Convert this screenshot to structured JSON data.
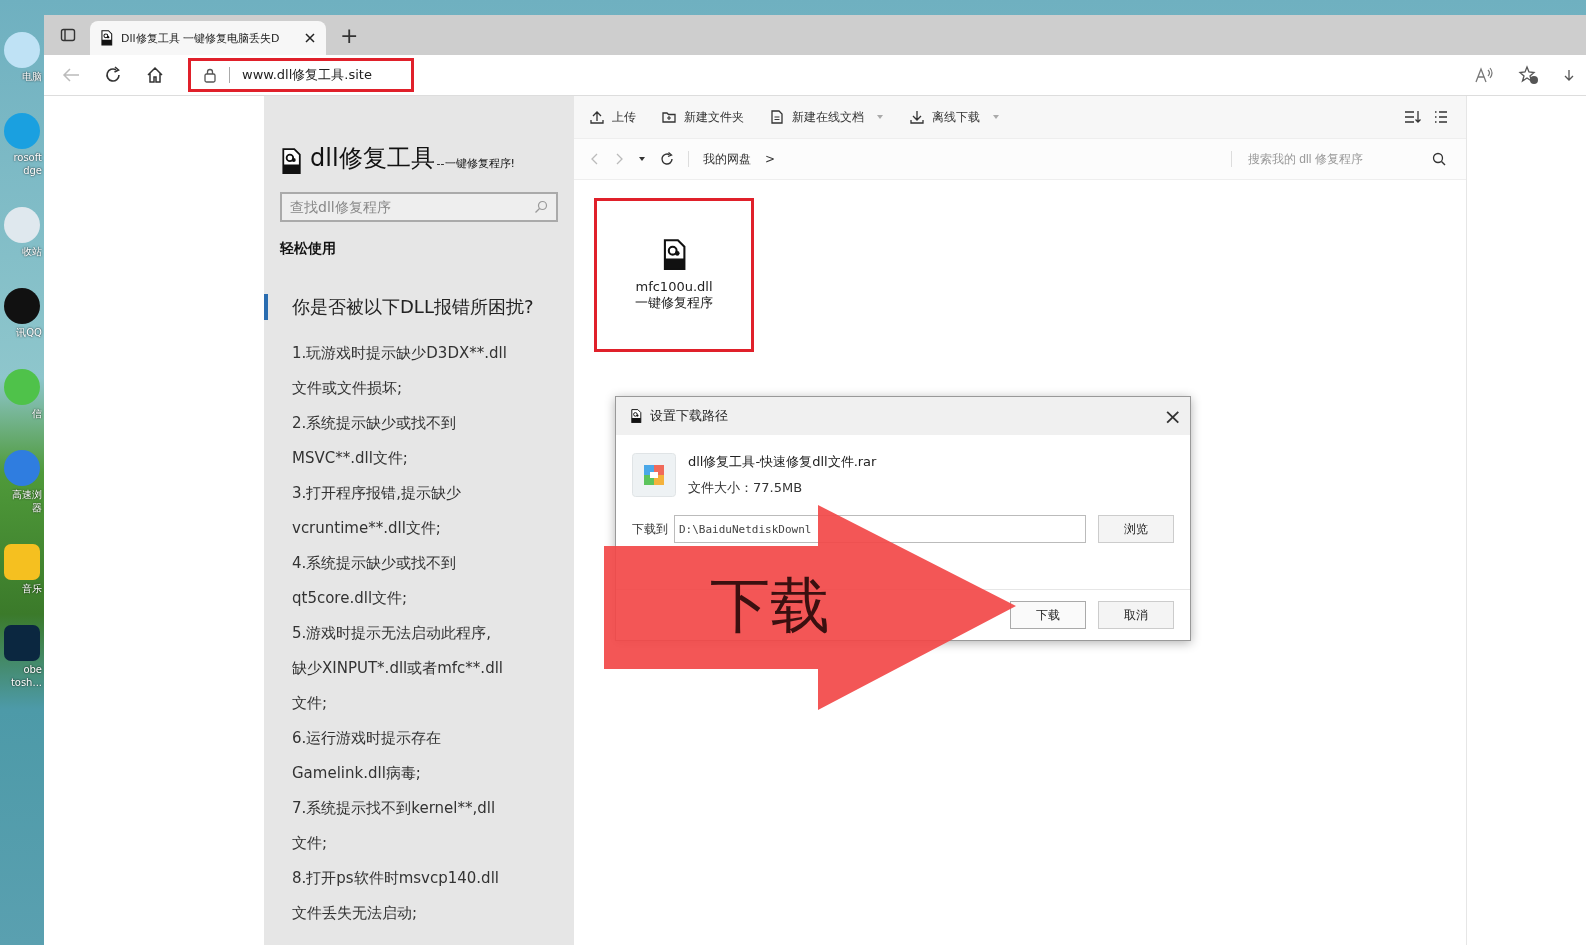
{
  "desktop_icons": [
    {
      "kind": "pc",
      "lines": [
        "电脑"
      ]
    },
    {
      "kind": "edge",
      "lines": [
        "rosoft",
        "dge"
      ]
    },
    {
      "kind": "bin",
      "lines": [
        "收站"
      ]
    },
    {
      "kind": "qq",
      "lines": [
        "讯QQ"
      ]
    },
    {
      "kind": "chat",
      "lines": [
        "信"
      ]
    },
    {
      "kind": "browser",
      "lines": [
        "高速浏",
        "器"
      ]
    },
    {
      "kind": "music",
      "lines": [
        "音乐"
      ]
    },
    {
      "kind": "ps",
      "lines": [
        "obe",
        "tosh..."
      ]
    }
  ],
  "browser": {
    "tabs": [
      {
        "title": "Dll修复工具 一键修复电脑丢失D",
        "selected": true
      }
    ],
    "new_tab": "+",
    "address": "www.dll修复工具.site"
  },
  "site": {
    "title": "dll修复工具",
    "subtitle": "--一键修复程序!",
    "search_placeholder": "查找dll修复程序",
    "section": "轻松使用",
    "heading": "你是否被以下DLL报错所困扰?",
    "lines": [
      "1.玩游戏时提示缺少D3DX**.dll",
      "文件或文件损坏;",
      "2.系统提示缺少或找不到",
      "MSVC**.dll文件;",
      "3.打开程序报错,提示缺少",
      "vcruntime**.dll文件;",
      "4.系统提示缺少或找不到",
      "qt5core.dll文件;",
      "5.游戏时提示无法启动此程序,",
      "缺少XINPUT*.dll或者mfc**.dll",
      "文件;",
      "6.运行游戏时提示存在",
      "Gamelink.dll病毒;",
      "7.系统提示找不到kernel**,dll",
      "文件;",
      "8.打开ps软件时msvcp140.dll",
      "文件丢失无法启动;"
    ]
  },
  "toolbar": [
    {
      "kind": "upload",
      "label": "上传",
      "dropdown": false
    },
    {
      "kind": "folder",
      "label": "新建文件夹",
      "dropdown": false
    },
    {
      "kind": "doc",
      "label": "新建在线文档",
      "dropdown": true
    },
    {
      "kind": "download",
      "label": "离线下载",
      "dropdown": true
    }
  ],
  "breadcrumb": {
    "items": [
      "我的网盘"
    ],
    "separator": ">"
  },
  "disk_search_placeholder": "搜索我的 dll 修复程序",
  "files": [
    {
      "lines": [
        "mfc100u.dll",
        "一键修复程序"
      ],
      "highlighted": true
    }
  ],
  "dialog": {
    "title": "设置下载路径",
    "close": "×",
    "file_name": "dll修复工具-快速修复dll文件.rar",
    "file_size": "文件大小：77.5MB",
    "path_label": "下载到",
    "path_value": "D:\\BaiduNetdiskDownl",
    "browse": "浏览",
    "buttons": [
      {
        "label": "下载",
        "kind": "primary"
      },
      {
        "label": "取消",
        "kind": "secondary"
      }
    ]
  },
  "annotation": {
    "arrow_text": "下载"
  }
}
